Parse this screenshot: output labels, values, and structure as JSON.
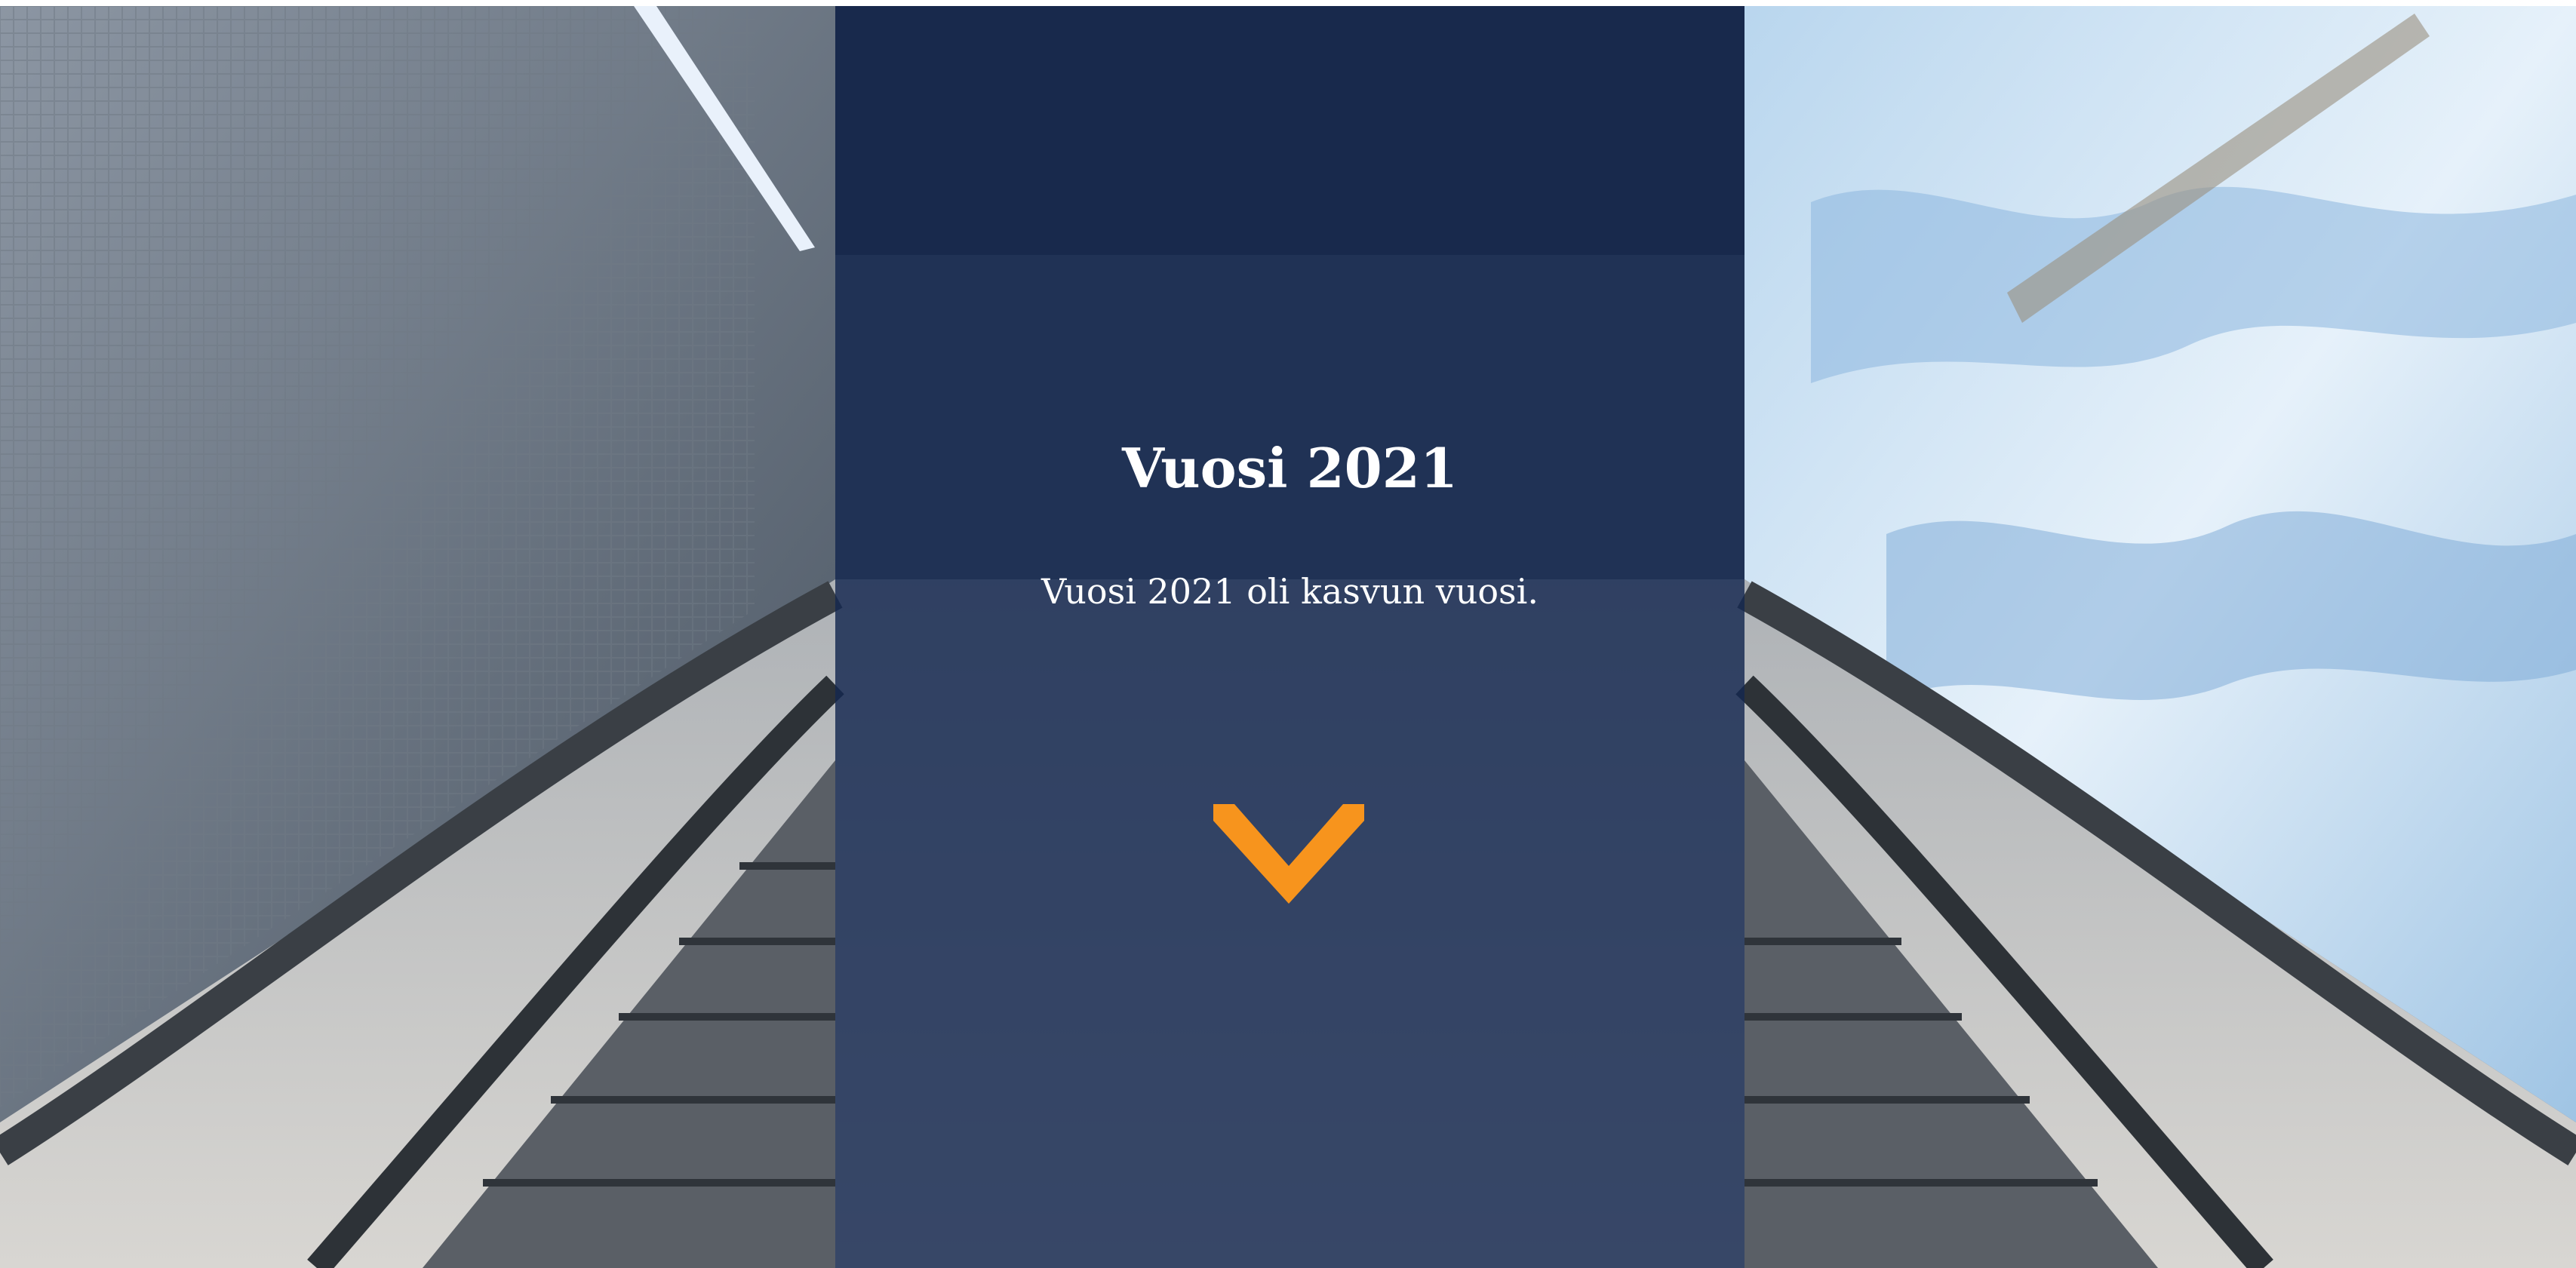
{
  "hero": {
    "title": "Vuosi 2021",
    "subtitle": "Vuosi 2021 oli kasvun vuosi.",
    "scroll_icon": "chevron-down-icon",
    "panel_color": "#13274f",
    "accent_color": "#f7941d"
  }
}
